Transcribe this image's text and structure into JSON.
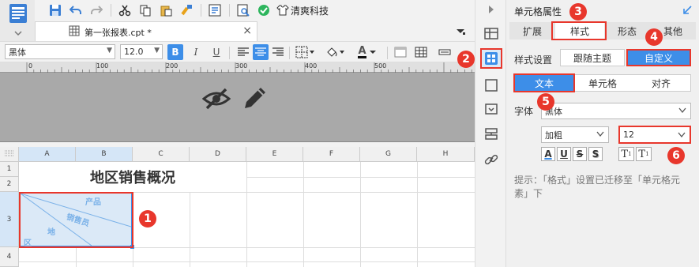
{
  "toolbar": {
    "save_tip": "save",
    "brand_button_label": "清爽科技"
  },
  "tab": {
    "title": "第一张报表.cpt *",
    "close_glyph": "×"
  },
  "format_bar": {
    "font_name": "黑体",
    "font_size": "12.0",
    "bold_label": "B",
    "italic_label": "I",
    "underline_label": "U",
    "color_letter": "A"
  },
  "ruler": {
    "marks": [
      "0",
      "100",
      "200",
      "300",
      "400",
      "500"
    ]
  },
  "sheet": {
    "columns": [
      "A",
      "B",
      "C",
      "D",
      "E",
      "F",
      "G",
      "H"
    ],
    "rows": [
      "1",
      "2",
      "3",
      "4"
    ],
    "title": "地区销售概况",
    "diag_product": "产品",
    "diag_salesperson": "销售员",
    "diag_region_1": "地",
    "diag_region_2": "区"
  },
  "panel": {
    "title": "单元格属性",
    "tabs": [
      "扩展",
      "样式",
      "形态",
      "其他"
    ],
    "style_setting_label": "样式设置",
    "follow_theme": "跟随主题",
    "custom": "自定义",
    "subtabs": [
      "文本",
      "单元格",
      "对齐"
    ],
    "font_label": "字体",
    "font_value": "黑体",
    "weight_value": "加粗",
    "size_value": "12",
    "deco_underline": "A",
    "deco_u": "U",
    "deco_s": "S",
    "deco_shadow": "S",
    "sup": "T",
    "sub": "T",
    "tip": "提示：「格式」设置已迁移至「单元格元素」下"
  },
  "annotations": [
    "1",
    "2",
    "3",
    "4",
    "5",
    "6"
  ],
  "colors": {
    "accent": "#3d8ee8",
    "badge_red": "#e8372c",
    "selection_blue": "#dbe9f7"
  }
}
